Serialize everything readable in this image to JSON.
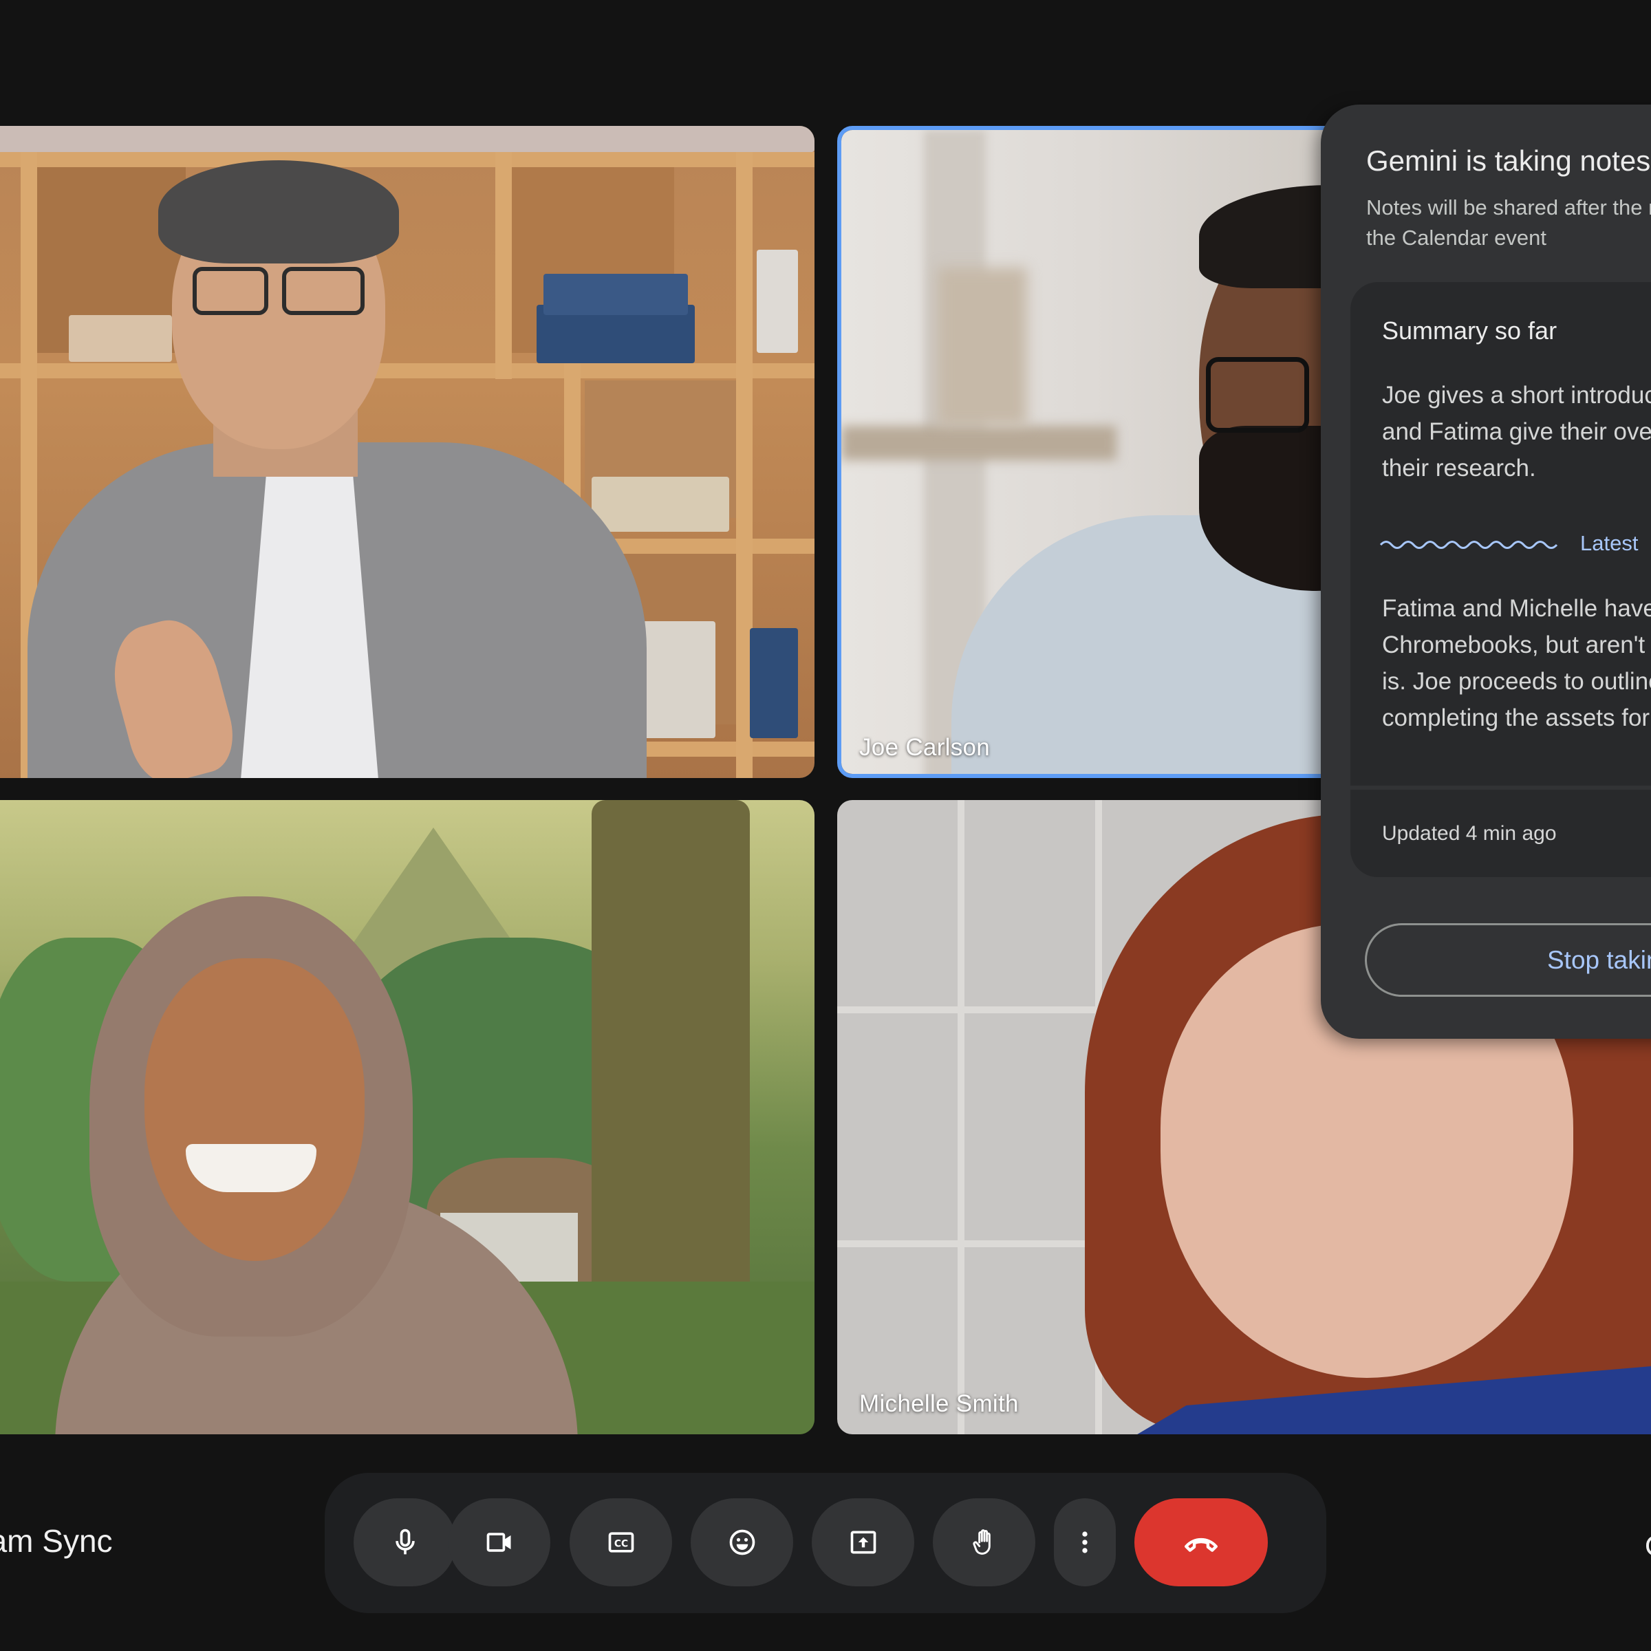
{
  "meeting": {
    "title": "Team Sync",
    "title_visible": "am Sync"
  },
  "participants": [
    {
      "name": "",
      "position": "top-left",
      "active_speaker": false
    },
    {
      "name": "Joe Carlson",
      "position": "top-right",
      "active_speaker": true
    },
    {
      "name": "",
      "position": "bottom-left",
      "active_speaker": false,
      "background": "fantasy-forest"
    },
    {
      "name": "Michelle Smith",
      "position": "bottom-right",
      "active_speaker": false
    }
  ],
  "gemini_panel": {
    "title": "Gemini is taking notes",
    "subtitle_lines": [
      "Notes will be shared after the meeting and attached to",
      "the Calendar event"
    ],
    "summary": {
      "heading": "Summary so far",
      "lines": [
        "Joe gives a short introduction. Michelle",
        "and Fatima give their overview of",
        "their research."
      ]
    },
    "latest": {
      "label": "Latest",
      "lines": [
        "Fatima and Michelle have used",
        "Chromebooks, but aren't sure what the",
        "is. Joe proceeds to outline",
        "completing the assets for"
      ]
    },
    "updated": "Updated 4 min ago",
    "stop_button": "Stop taking notes"
  },
  "controls": [
    {
      "id": "mic",
      "icon": "mic-icon",
      "label": "Microphone"
    },
    {
      "id": "camera",
      "icon": "videocam-icon",
      "label": "Camera"
    },
    {
      "id": "captions",
      "icon": "closed-captions-icon",
      "label": "Captions"
    },
    {
      "id": "reactions",
      "icon": "emoji-icon",
      "label": "Reactions"
    },
    {
      "id": "present",
      "icon": "present-screen-icon",
      "label": "Present"
    },
    {
      "id": "raise-hand",
      "icon": "hand-icon",
      "label": "Raise hand"
    },
    {
      "id": "more",
      "icon": "more-vert-icon",
      "label": "More options"
    },
    {
      "id": "end-call",
      "icon": "call-end-icon",
      "label": "Leave call"
    }
  ],
  "colors": {
    "background": "#131313",
    "panel": "#323335",
    "card": "#28292b",
    "accent": "#a8c7fa",
    "active_border": "#5d9cf5",
    "end_call": "#dc362e"
  }
}
